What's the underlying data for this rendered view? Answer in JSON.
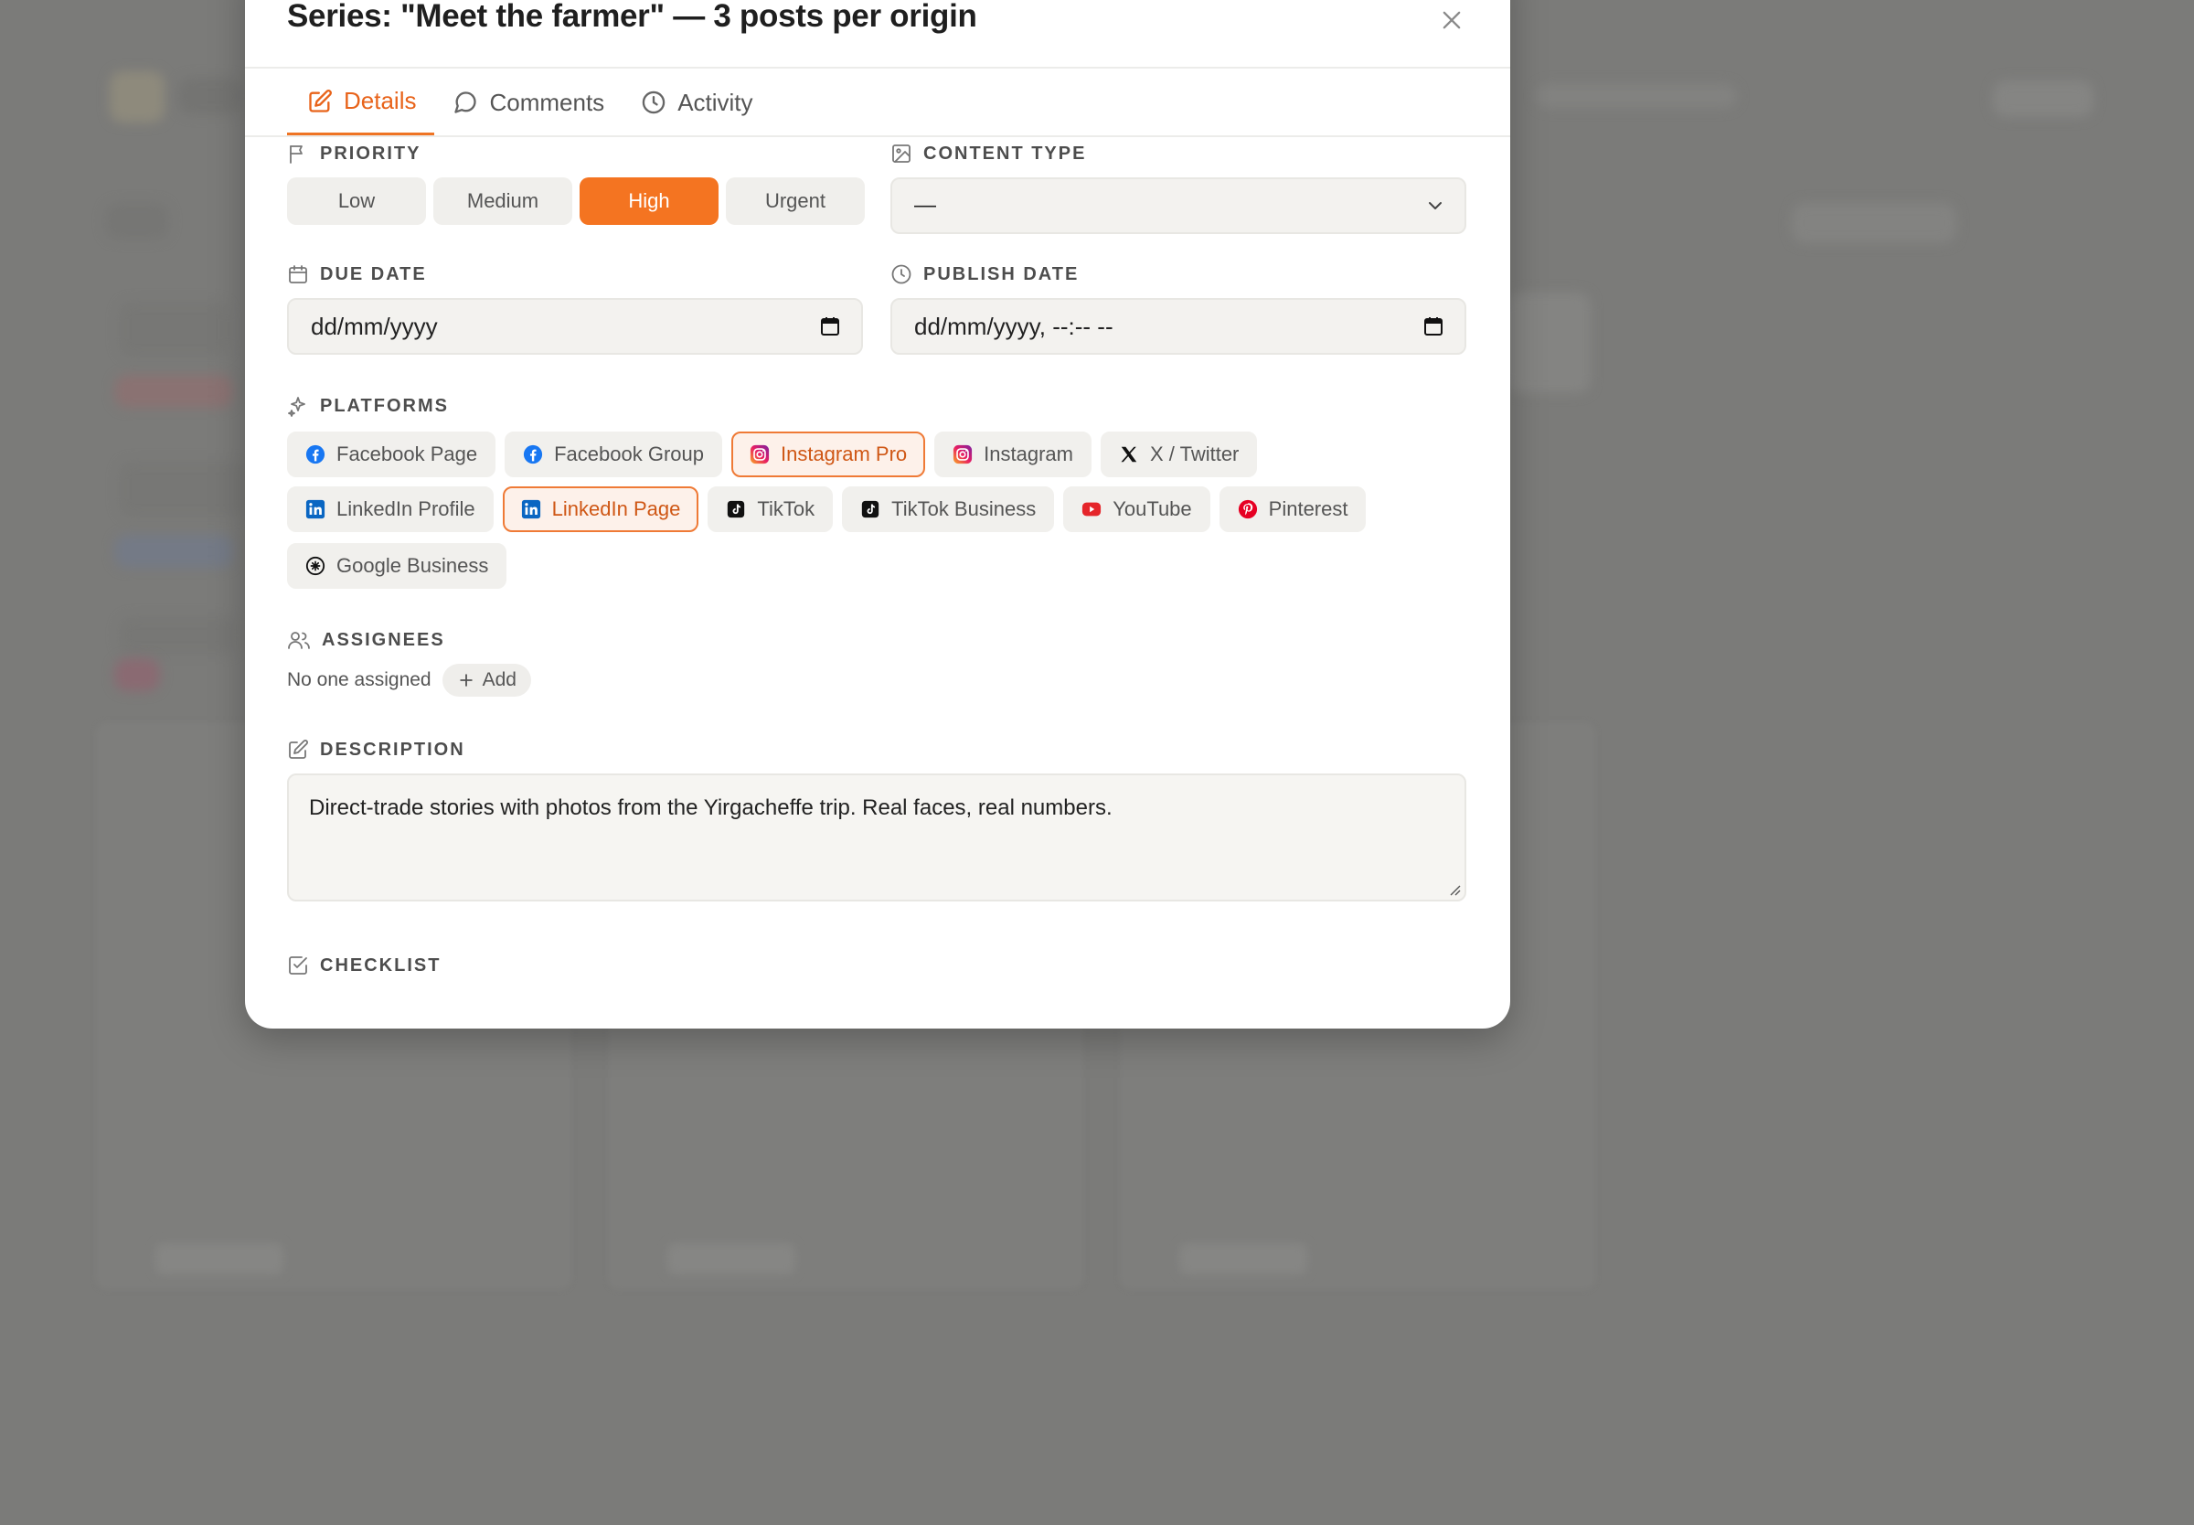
{
  "modal": {
    "title": "Series: \"Meet the farmer\" — 3 posts per origin"
  },
  "tabs": [
    {
      "label": "Details",
      "icon": "edit-icon",
      "active": true
    },
    {
      "label": "Comments",
      "icon": "comment-icon",
      "active": false
    },
    {
      "label": "Activity",
      "icon": "clock-icon",
      "active": false
    }
  ],
  "priority": {
    "label": "PRIORITY",
    "options": [
      "Low",
      "Medium",
      "High",
      "Urgent"
    ],
    "selected": "High"
  },
  "content_type": {
    "label": "CONTENT TYPE",
    "value": "—"
  },
  "due_date": {
    "label": "DUE DATE",
    "value": "dd/mm/yyyy"
  },
  "publish_date": {
    "label": "PUBLISH DATE",
    "value": "dd/mm/yyyy, --:-- --"
  },
  "platforms": {
    "label": "PLATFORMS",
    "items": [
      {
        "label": "Facebook Page",
        "icon": "facebook-icon",
        "selected": false
      },
      {
        "label": "Facebook Group",
        "icon": "facebook-icon",
        "selected": false
      },
      {
        "label": "Instagram Pro",
        "icon": "instagram-icon",
        "selected": true
      },
      {
        "label": "Instagram",
        "icon": "instagram-icon",
        "selected": false
      },
      {
        "label": "X / Twitter",
        "icon": "x-icon",
        "selected": false
      },
      {
        "label": "LinkedIn Profile",
        "icon": "linkedin-icon",
        "selected": false
      },
      {
        "label": "LinkedIn Page",
        "icon": "linkedin-icon",
        "selected": true
      },
      {
        "label": "TikTok",
        "icon": "tiktok-icon",
        "selected": false
      },
      {
        "label": "TikTok Business",
        "icon": "tiktok-icon",
        "selected": false
      },
      {
        "label": "YouTube",
        "icon": "youtube-icon",
        "selected": false
      },
      {
        "label": "Pinterest",
        "icon": "pinterest-icon",
        "selected": false
      },
      {
        "label": "Google Business",
        "icon": "google-business-icon",
        "selected": false
      }
    ]
  },
  "assignees": {
    "label": "ASSIGNEES",
    "empty_text": "No one assigned",
    "add_label": "Add"
  },
  "description": {
    "label": "DESCRIPTION",
    "value": "Direct-trade stories with photos from the Yirgacheffe trip. Real faces, real numbers."
  },
  "checklist": {
    "label": "CHECKLIST"
  },
  "colors": {
    "accent": "#f47421",
    "accent_text": "#e8631a",
    "selected_chip_bg": "#fdf1ea",
    "overlay": "#7b7b79"
  }
}
